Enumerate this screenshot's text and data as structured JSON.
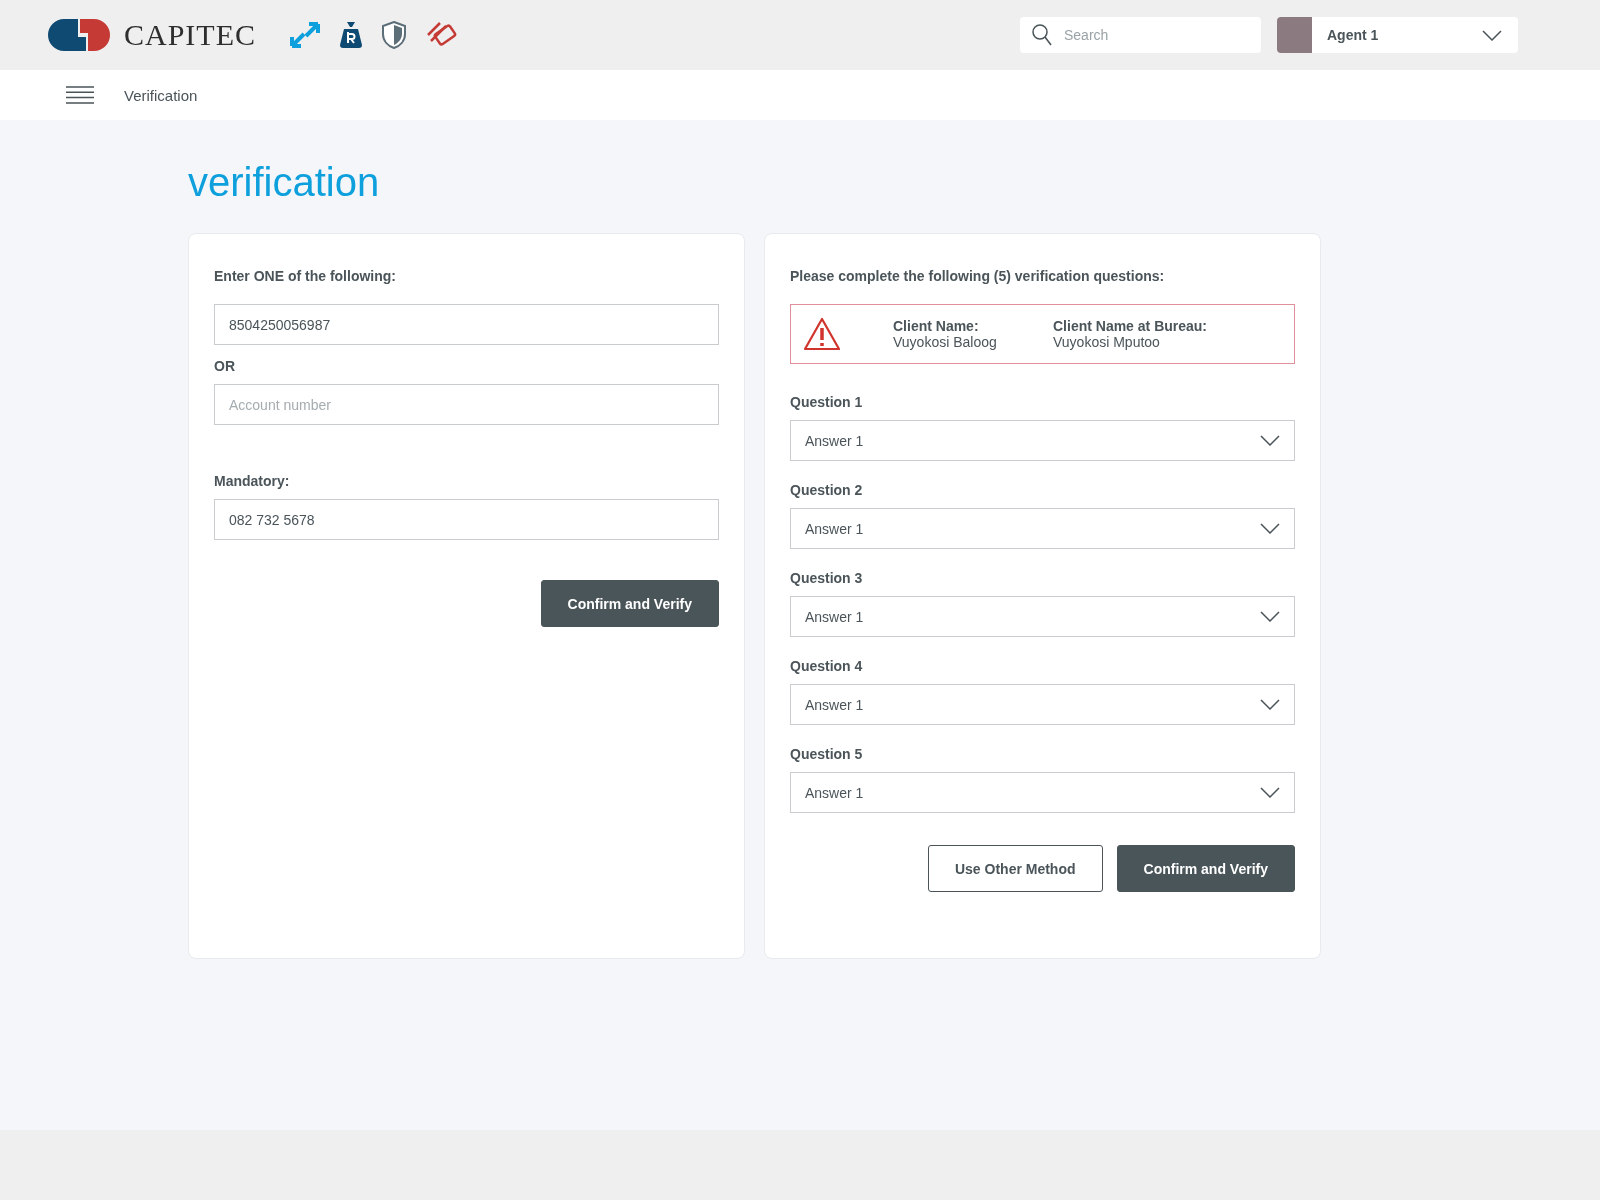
{
  "header": {
    "logo_text": "CAPITEC",
    "search": {
      "placeholder": "Search"
    },
    "user": {
      "name": "Agent 1"
    }
  },
  "nav": {
    "title": "Verification"
  },
  "page_title": "verification",
  "left_card": {
    "heading": "Enter ONE of the following:",
    "id_field": {
      "value": "8504250056987"
    },
    "separator": "OR",
    "account_field": {
      "placeholder": "Account number"
    },
    "mandatory_label": "Mandatory:",
    "phone_field": {
      "value": "082 732 5678"
    },
    "button": "Confirm and Verify"
  },
  "right_card": {
    "heading": "Please complete the following (5) verification questions:",
    "alert": {
      "items": [
        {
          "label": "Client Name:",
          "value": "Vuyokosi Baloog"
        },
        {
          "label": "Client Name at Bureau:",
          "value": "Vuyokosi Mputoo"
        }
      ]
    },
    "questions": [
      {
        "label": "Question 1",
        "answer": "Answer 1"
      },
      {
        "label": "Question 2",
        "answer": "Answer 1"
      },
      {
        "label": "Question 3",
        "answer": "Answer 1"
      },
      {
        "label": "Question 4",
        "answer": "Answer 1"
      },
      {
        "label": "Question 5",
        "answer": "Answer 1"
      }
    ],
    "buttons": [
      {
        "label": "Use Other Method",
        "kind": "secondary"
      },
      {
        "label": "Confirm and Verify",
        "kind": "primary"
      }
    ]
  }
}
